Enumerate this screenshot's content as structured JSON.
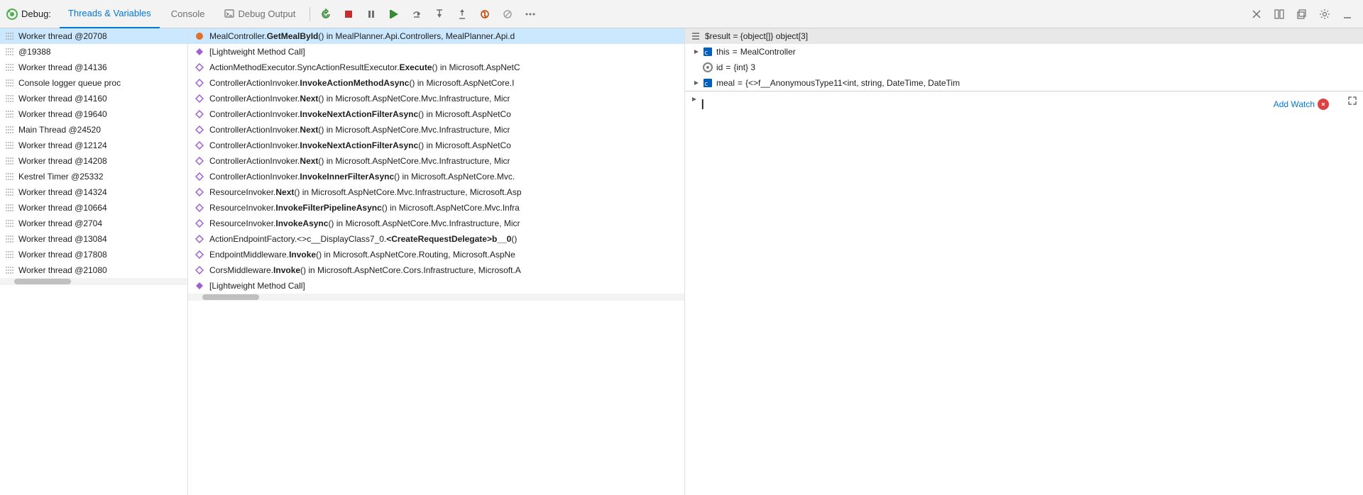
{
  "toolbar": {
    "debug_label": "Debug:",
    "tab_threads": "Threads & Variables",
    "tab_console": "Console",
    "tab_debug_output": "Debug Output",
    "btn_restart": "restart",
    "btn_stop": "stop",
    "btn_pause": "pause",
    "btn_continue": "continue",
    "btn_step_over": "step over",
    "btn_step_into": "step into",
    "btn_step_out": "step out",
    "btn_hot_reload": "hot reload",
    "btn_more": "more",
    "btn_close": "close",
    "btn_layout": "layout",
    "btn_restore": "restore",
    "btn_settings": "settings",
    "btn_minimize": "minimize"
  },
  "threads": [
    {
      "id": 1,
      "label": "Worker thread @20708",
      "icon": "wavy",
      "selected": true
    },
    {
      "id": 2,
      "label": "@19388",
      "icon": "wavy",
      "selected": false
    },
    {
      "id": 3,
      "label": "Worker thread @14136",
      "icon": "wavy",
      "selected": false
    },
    {
      "id": 4,
      "label": "Console logger queue proc",
      "icon": "wavy",
      "selected": false
    },
    {
      "id": 5,
      "label": "Worker thread @14160",
      "icon": "wavy",
      "selected": false
    },
    {
      "id": 6,
      "label": "Worker thread @19640",
      "icon": "wavy",
      "selected": false
    },
    {
      "id": 7,
      "label": "Main Thread @24520",
      "icon": "wavy",
      "selected": false
    },
    {
      "id": 8,
      "label": "Worker thread @12124",
      "icon": "wavy",
      "selected": false
    },
    {
      "id": 9,
      "label": "Worker thread @14208",
      "icon": "wavy",
      "selected": false
    },
    {
      "id": 10,
      "label": "Kestrel Timer @25332",
      "icon": "wavy",
      "selected": false
    },
    {
      "id": 11,
      "label": "Worker thread @14324",
      "icon": "wavy",
      "selected": false
    },
    {
      "id": 12,
      "label": "Worker thread @10664",
      "icon": "wavy",
      "selected": false
    },
    {
      "id": 13,
      "label": "Worker thread @2704",
      "icon": "wavy",
      "selected": false
    },
    {
      "id": 14,
      "label": "Worker thread @13084",
      "icon": "wavy",
      "selected": false
    },
    {
      "id": 15,
      "label": "Worker thread @17808",
      "icon": "wavy",
      "selected": false
    },
    {
      "id": 16,
      "label": "Worker thread @21080",
      "icon": "wavy",
      "selected": false
    }
  ],
  "callstack": [
    {
      "id": 1,
      "icon": "orange-dot",
      "text_plain": "MealController.",
      "text_bold": "GetMealById",
      "text_rest": "() in MealPlanner.Api.Controllers, MealPlanner.Api.d",
      "selected": true
    },
    {
      "id": 2,
      "icon": "diamond-filled",
      "text_plain": "[Lightweight Method Call]",
      "text_bold": "",
      "text_rest": "",
      "selected": false
    },
    {
      "id": 3,
      "icon": "diamond-outline",
      "text_plain": "ActionMethodExecutor.SyncActionResultExecutor.",
      "text_bold": "Execute",
      "text_rest": "() in Microsoft.AspNetC",
      "selected": false
    },
    {
      "id": 4,
      "icon": "diamond-outline",
      "text_plain": "ControllerActionInvoker.",
      "text_bold": "InvokeActionMethodAsync",
      "text_rest": "() in Microsoft.AspNetCore.I",
      "selected": false
    },
    {
      "id": 5,
      "icon": "diamond-outline",
      "text_plain": "ControllerActionInvoker.",
      "text_bold": "Next",
      "text_rest": "() in Microsoft.AspNetCore.Mvc.Infrastructure, Micr",
      "selected": false
    },
    {
      "id": 6,
      "icon": "diamond-outline",
      "text_plain": "ControllerActionInvoker.",
      "text_bold": "InvokeNextActionFilterAsync",
      "text_rest": "() in Microsoft.AspNetCo",
      "selected": false
    },
    {
      "id": 7,
      "icon": "diamond-outline",
      "text_plain": "ControllerActionInvoker.",
      "text_bold": "Next",
      "text_rest": "() in Microsoft.AspNetCore.Mvc.Infrastructure, Micr",
      "selected": false
    },
    {
      "id": 8,
      "icon": "diamond-outline",
      "text_plain": "ControllerActionInvoker.",
      "text_bold": "InvokeNextActionFilterAsync",
      "text_rest": "() in Microsoft.AspNetCo",
      "selected": false
    },
    {
      "id": 9,
      "icon": "diamond-outline",
      "text_plain": "ControllerActionInvoker.",
      "text_bold": "Next",
      "text_rest": "() in Microsoft.AspNetCore.Mvc.Infrastructure, Micr",
      "selected": false
    },
    {
      "id": 10,
      "icon": "diamond-outline",
      "text_plain": "ControllerActionInvoker.",
      "text_bold": "InvokeInnerFilterAsync",
      "text_rest": "() in Microsoft.AspNetCore.Mvc.",
      "selected": false
    },
    {
      "id": 11,
      "icon": "diamond-outline",
      "text_plain": "ResourceInvoker.",
      "text_bold": "Next",
      "text_rest": "() in Microsoft.AspNetCore.Mvc.Infrastructure, Microsoft.Asp",
      "selected": false
    },
    {
      "id": 12,
      "icon": "diamond-outline",
      "text_plain": "ResourceInvoker.",
      "text_bold": "InvokeFilterPipelineAsync",
      "text_rest": "() in Microsoft.AspNetCore.Mvc.Infra",
      "selected": false
    },
    {
      "id": 13,
      "icon": "diamond-outline",
      "text_plain": "ResourceInvoker.",
      "text_bold": "InvokeAsync",
      "text_rest": "() in Microsoft.AspNetCore.Mvc.Infrastructure, Micr",
      "selected": false
    },
    {
      "id": 14,
      "icon": "diamond-outline",
      "text_plain": "ActionEndpointFactory.<>c__DisplayClass7_0.",
      "text_bold": "<CreateRequestDelegate>b__0",
      "text_rest": "()",
      "selected": false
    },
    {
      "id": 15,
      "icon": "diamond-outline",
      "text_plain": "EndpointMiddleware.",
      "text_bold": "Invoke",
      "text_rest": "() in Microsoft.AspNetCore.Routing, Microsoft.AspNe",
      "selected": false
    },
    {
      "id": 16,
      "icon": "diamond-outline",
      "text_plain": "CorsMiddleware.",
      "text_bold": "Invoke",
      "text_rest": "() in Microsoft.AspNetCore.Cors.Infrastructure, Microsoft.A",
      "selected": false
    },
    {
      "id": 17,
      "icon": "diamond-filled",
      "text_plain": "[Lightweight Method Call]",
      "text_bold": "",
      "text_rest": "",
      "selected": false
    }
  ],
  "variables": {
    "result_label": "$result = {object[]} object[3]",
    "items": [
      {
        "id": 1,
        "indent": 0,
        "expandable": true,
        "expanded": true,
        "icon": "blue-box",
        "name": "this",
        "equals": "=",
        "value": "MealController",
        "type": ""
      },
      {
        "id": 2,
        "indent": 0,
        "expandable": false,
        "expanded": false,
        "icon": "target",
        "name": "id",
        "equals": "=",
        "value": "{int} 3",
        "type": ""
      },
      {
        "id": 3,
        "indent": 0,
        "expandable": true,
        "expanded": false,
        "icon": "blue-box",
        "name": "meal",
        "equals": "=",
        "value": "{<>f__AnonymousType11<int, string, DateTime, DateTim",
        "type": ""
      }
    ]
  },
  "watch": {
    "add_watch_label": "Add Watch",
    "placeholder": ""
  }
}
